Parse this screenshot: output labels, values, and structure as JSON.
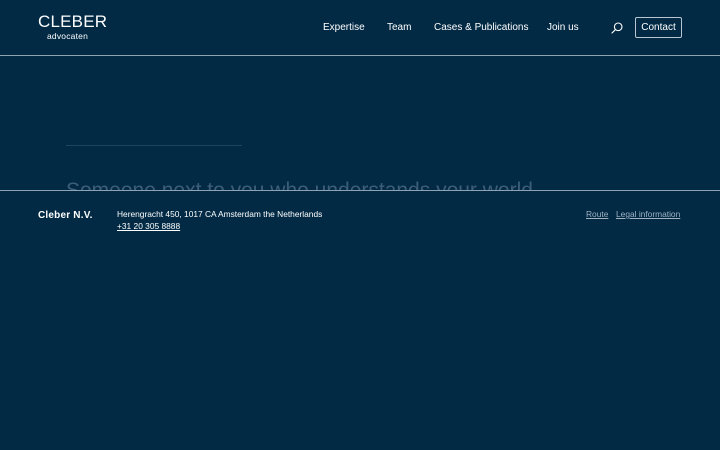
{
  "header": {
    "logo": {
      "name": "CLEBER",
      "subtitle": "advocaten"
    },
    "nav": [
      {
        "label": "Expertise"
      },
      {
        "label": "Team"
      },
      {
        "label": "Cases & Publications"
      },
      {
        "label": "Join us"
      }
    ],
    "search_icon": "search-icon",
    "contact_label": "Contact"
  },
  "hero": {
    "heading": "Someone next to you who understands your world"
  },
  "footer": {
    "company": "Cleber N.V.",
    "address": "Herengracht 450, 1017 CA Amsterdam the Netherlands",
    "phone": "+31 20 305 8888",
    "links": [
      {
        "label": "Route"
      },
      {
        "label": "Legal information"
      }
    ]
  },
  "colors": {
    "background": "#022A45",
    "divider": "#8fa3b3",
    "text": "#ffffff",
    "muted_link": "#9fb2c2"
  }
}
